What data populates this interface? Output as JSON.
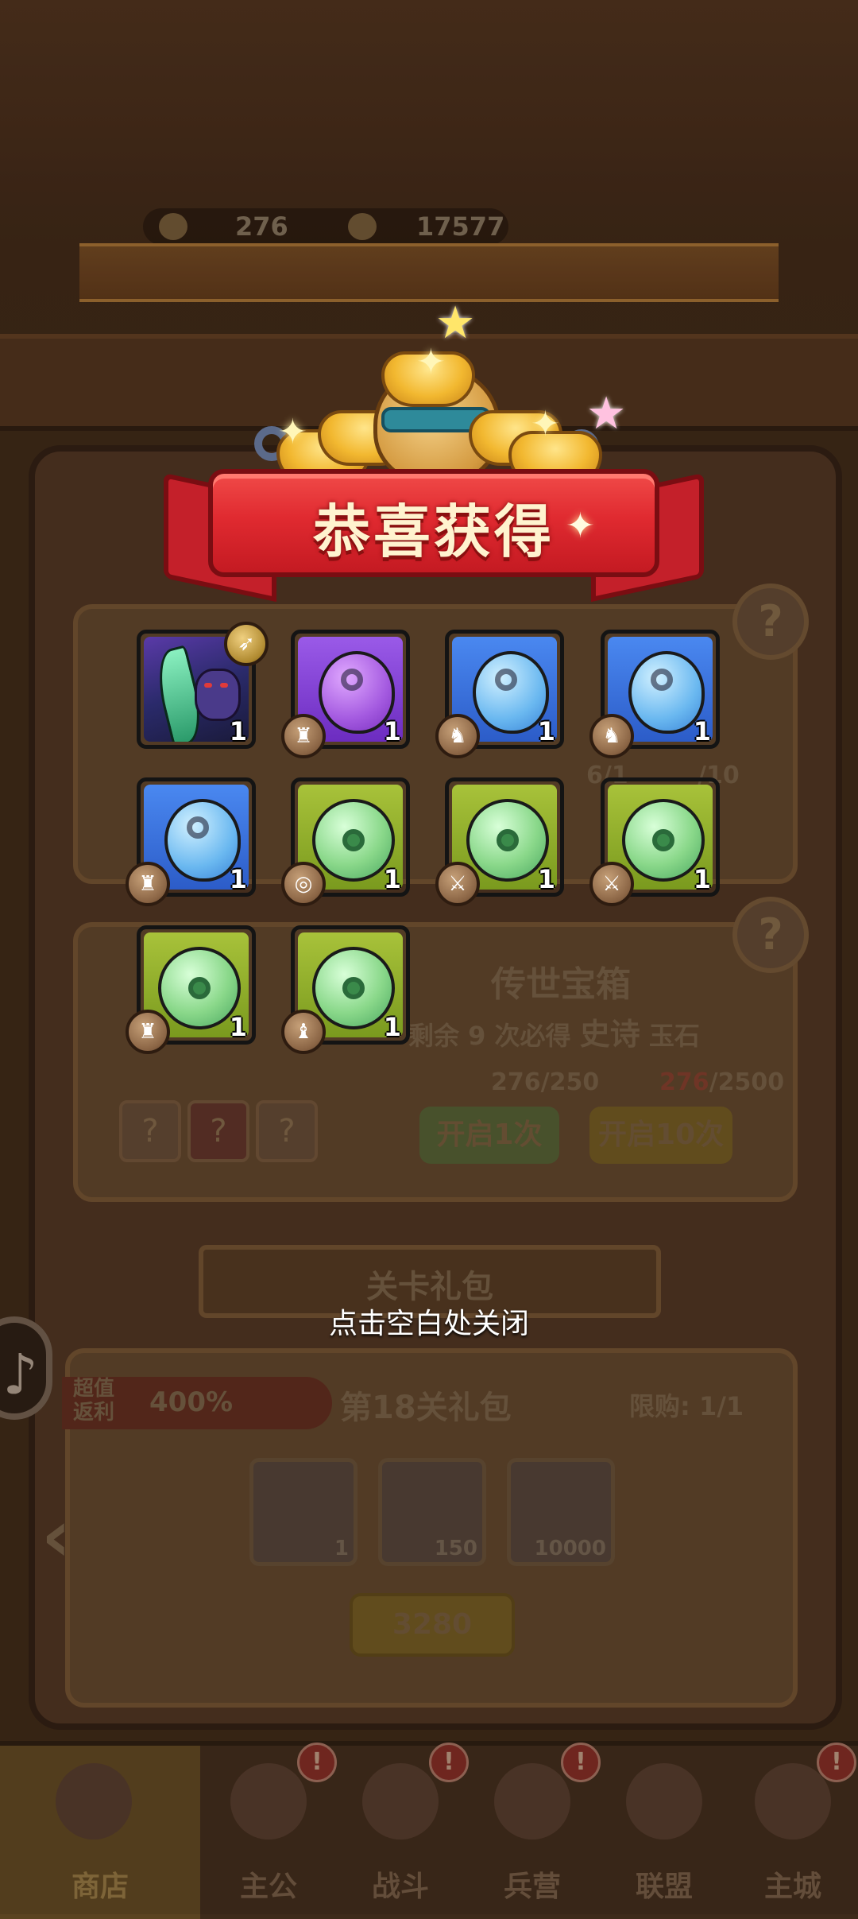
{
  "background": {
    "currency": {
      "ingot_count": "276",
      "coin_count": "17577"
    },
    "treasure_card": {
      "title": "传世宝箱",
      "subtitle_prefix": "剩余 9 次必得",
      "subtitle_highlight": "史诗",
      "subtitle_suffix": "玉石",
      "cost_single": "276/250",
      "cost_ten_owned": "276",
      "cost_ten_total": "/2500",
      "open_once": "开启1次",
      "open_ten": "开启10次",
      "help": "?"
    },
    "upper_card": {
      "partial_a": "6/1",
      "partial_b": "/10",
      "help": "?"
    },
    "stage_gift": {
      "section_title": "关卡礼包",
      "rebate_label": "超值返利",
      "rebate_value": "400%",
      "gift_name": "第18关礼包",
      "limit": "限购: 1/1",
      "items": [
        {
          "name": "building",
          "qty": "1"
        },
        {
          "name": "stone",
          "qty": "150"
        },
        {
          "name": "coin",
          "qty": "10000"
        }
      ],
      "price": "3280"
    }
  },
  "popup": {
    "title": "恭喜获得",
    "rewards": [
      {
        "kind": "hero",
        "bg": "gold",
        "badge": "bow-icon",
        "qty": "1"
      },
      {
        "kind": "gourd",
        "color": "purple",
        "bg": "purple",
        "badge": "helmet-icon",
        "qty": "1"
      },
      {
        "kind": "gourd",
        "color": "blue",
        "bg": "blue",
        "badge": "boot-icon",
        "qty": "1"
      },
      {
        "kind": "gourd",
        "color": "blue",
        "bg": "blue",
        "badge": "boot-icon",
        "qty": "1"
      },
      {
        "kind": "gourd",
        "color": "blue",
        "bg": "blue",
        "badge": "helmet-icon",
        "qty": "1"
      },
      {
        "kind": "disc",
        "bg": "green",
        "badge": "ring-icon",
        "qty": "1"
      },
      {
        "kind": "disc",
        "bg": "green",
        "badge": "sword-icon",
        "qty": "1"
      },
      {
        "kind": "disc",
        "bg": "green",
        "badge": "sword-icon",
        "qty": "1"
      },
      {
        "kind": "disc",
        "bg": "green",
        "badge": "helmet-icon",
        "qty": "1"
      },
      {
        "kind": "disc",
        "bg": "green",
        "badge": "armor-icon",
        "qty": "1"
      }
    ],
    "close_hint": "点击空白处关闭"
  },
  "bottom_nav": {
    "items": [
      {
        "label": "商店",
        "active": true
      },
      {
        "label": "主公",
        "badge": "!"
      },
      {
        "label": "战斗",
        "badge": "!"
      },
      {
        "label": "兵营",
        "badge": "!"
      },
      {
        "label": "联盟"
      },
      {
        "label": "主城",
        "badge": "!"
      }
    ]
  },
  "colors": {
    "ribbon_red": "#e02a30",
    "title_cream": "#fff3cf",
    "qty_white": "#ffffff"
  }
}
